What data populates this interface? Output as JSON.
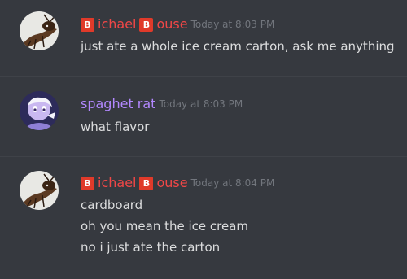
{
  "messages": [
    {
      "author_parts": [
        "ichael",
        "ouse"
      ],
      "author_emoji": "B",
      "author_color": "#f04747",
      "timestamp": "Today at 8:03 PM",
      "avatar": "ant-icon",
      "lines": [
        "just ate a whole ice cream carton, ask me anything"
      ]
    },
    {
      "author": "spaghet rat",
      "author_color": "#b388ff",
      "timestamp": "Today at 8:03 PM",
      "avatar": "cartoon-character-icon",
      "lines": [
        "what flavor"
      ]
    },
    {
      "author_parts": [
        "ichael",
        "ouse"
      ],
      "author_emoji": "B",
      "author_color": "#f04747",
      "timestamp": "Today at 8:04 PM",
      "avatar": "ant-icon",
      "lines": [
        "cardboard",
        "oh you mean the ice cream",
        "no i just ate the carton"
      ]
    }
  ],
  "theme": {
    "background": "#36393f",
    "text": "#dcddde",
    "timestamp": "#72767d"
  }
}
